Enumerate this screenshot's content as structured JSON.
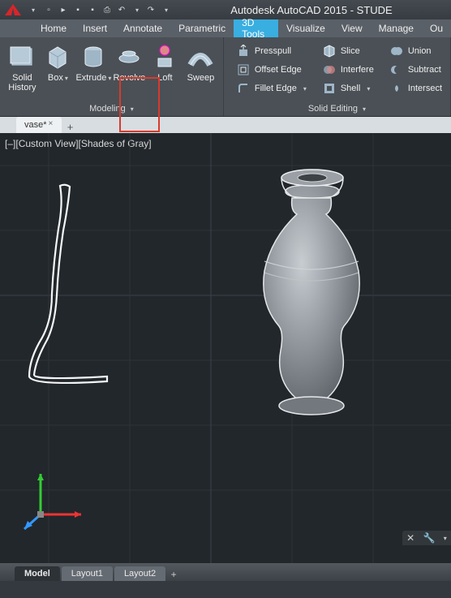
{
  "app": {
    "title": "Autodesk AutoCAD 2015 - STUDE"
  },
  "menubar": {
    "items": [
      "Home",
      "Insert",
      "Annotate",
      "Parametric",
      "3D Tools",
      "Visualize",
      "View",
      "Manage",
      "Ou"
    ],
    "active_index": 4
  },
  "ribbon": {
    "panel_modeling": {
      "title": "Modeling",
      "buttons": {
        "solid_history": "Solid\nHistory",
        "box": "Box",
        "extrude": "Extrude",
        "revolve": "Revolve",
        "loft": "Loft",
        "sweep": "Sweep"
      }
    },
    "panel_solid_editing": {
      "title": "Solid Editing",
      "col1": {
        "presspull": "Presspull",
        "offset_edge": "Offset Edge",
        "fillet_edge": "Fillet Edge"
      },
      "col2": {
        "slice": "Slice",
        "interfere": "Interfere",
        "shell": "Shell"
      },
      "col3": {
        "union": "Union",
        "subtract": "Subtract",
        "intersect": "Intersect"
      }
    }
  },
  "tabs": {
    "doc1": "vase*"
  },
  "viewport": {
    "controls_minus": "–",
    "controls_view": "Custom View",
    "controls_style": "Shades of Gray"
  },
  "layout_tabs": {
    "model": "Model",
    "layout1": "Layout1",
    "layout2": "Layout2"
  }
}
